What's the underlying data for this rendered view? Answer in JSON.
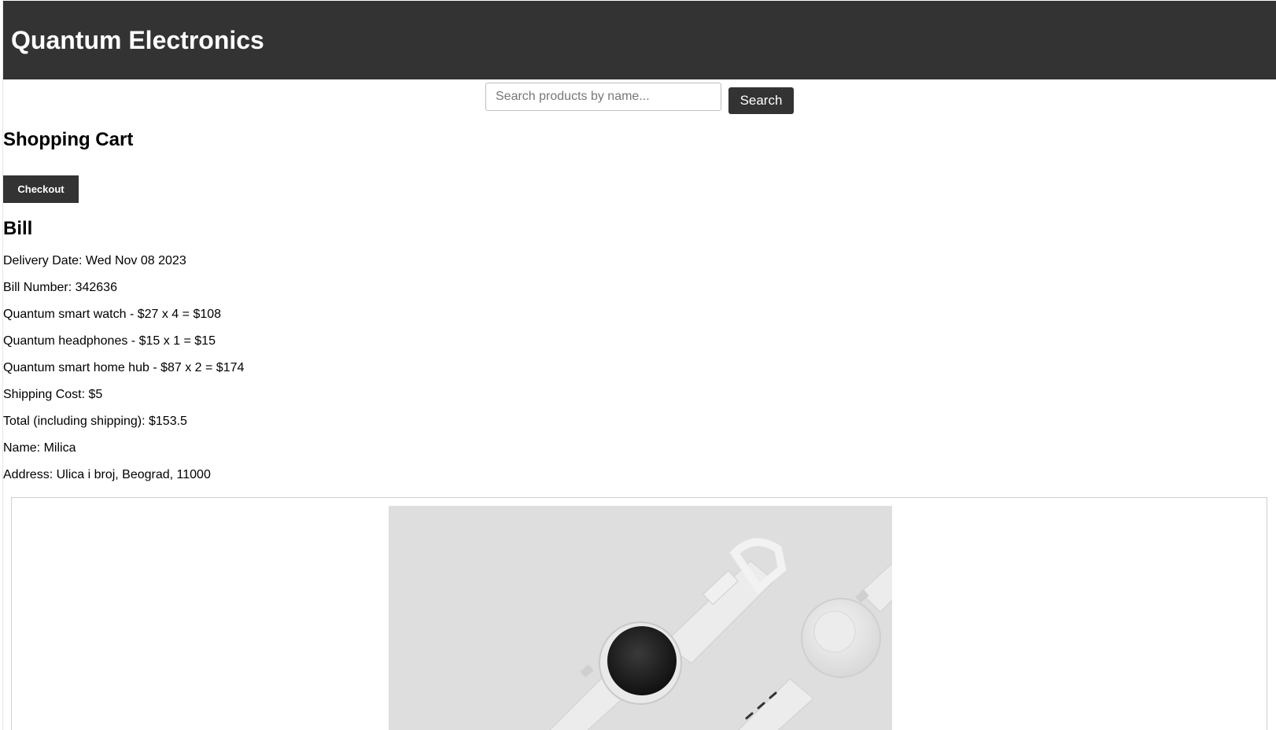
{
  "header": {
    "title": "Quantum Electronics",
    "background_color": "#333333"
  },
  "search": {
    "placeholder": "Search products by name...",
    "value": "",
    "button_label": "Search"
  },
  "cart": {
    "title": "Shopping Cart",
    "checkout_label": "Checkout"
  },
  "bill": {
    "title": "Bill",
    "lines": [
      "Delivery Date: Wed Nov 08 2023",
      "Bill Number: 342636",
      "Quantum smart watch - $27 x 4 = $108",
      "Quantum headphones - $15 x 1 = $15",
      "Quantum smart home hub - $87 x 2 = $174",
      "Shipping Cost: $5",
      "Total (including shipping): $153.5",
      "Name: Milica",
      "Address: Ulica i broj, Beograd, 11000"
    ]
  },
  "product_card": {
    "image_icon": "smart-watch-product-image"
  }
}
